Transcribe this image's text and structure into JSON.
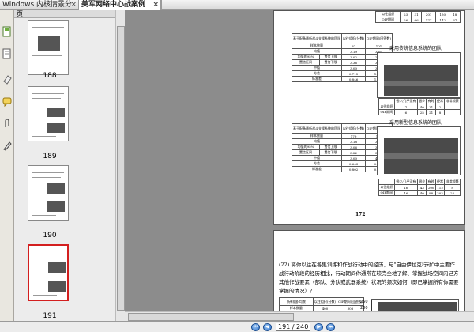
{
  "tabs": [
    {
      "label": "Windows 内核情景分"
    },
    {
      "label": "美军网络中心战案例"
    }
  ],
  "thumbnail_pane": {
    "header_label": "页",
    "pages": [
      {
        "label": "188"
      },
      {
        "label": "189"
      },
      {
        "label": "190"
      },
      {
        "label": "191",
        "selected": true
      }
    ]
  },
  "page1": {
    "table_top": {
      "rows": [
        [
          "以往组织",
          "23",
          "31",
          "201",
          "150",
          "18"
        ],
        [
          "OIF期间",
          "26",
          "66",
          "177",
          "142",
          "67"
        ]
      ]
    },
    "table1": {
      "header": [
        "基于配备最新战斗支援系统的团队",
        "以往组织(分数)",
        "OIF期间(回答数)"
      ],
      "rows": [
        [
          "样本数量",
          "97",
          "101"
        ],
        [
          "均值",
          "3.19",
          "3.09"
        ],
        [
          "均值的95%",
          "置信上限",
          "3.02",
          "2.68"
        ],
        [
          "置信区间",
          "置信下限",
          "3.36",
          "3.30"
        ],
        [
          "中值",
          "3.00",
          "3.00"
        ],
        [
          "方差",
          "0.715",
          "1.122"
        ],
        [
          "标准差",
          "0.846",
          "1.059"
        ]
      ]
    },
    "chart1": {
      "title": "采用传统信息系统的团队"
    },
    "small_table1": {
      "header": [
        "很少/几乎没有",
        "很少",
        "有时",
        "经常",
        "非常频繁"
      ],
      "rows": [
        [
          "以往组织",
          "7",
          "40",
          "31",
          "2"
        ],
        [
          "OIF期间",
          "6",
          "25",
          "21",
          "8"
        ]
      ]
    },
    "table2": {
      "header": [
        "基于配备最新战斗支援系统的团队",
        "以往组织(分数)",
        "OIF期间(回答数)"
      ],
      "rows": [
        [
          "样本数量",
          "179",
          "161"
        ],
        [
          "均值",
          "3.18",
          "3.31"
        ],
        [
          "均值的95%",
          "置信上限",
          "3.06",
          "3.42"
        ],
        [
          "置信区间",
          "置信下限",
          "3.22",
          "3.41"
        ],
        [
          "中值",
          "3.00",
          "4.00"
        ],
        [
          "方差",
          "0.643",
          "0.928"
        ],
        [
          "标准差",
          "0.802",
          "0.961"
        ]
      ]
    },
    "chart2": {
      "title": "采用新型信息系统的团队"
    },
    "small_table2": {
      "header": [
        "很少/几乎没有",
        "很少",
        "有时",
        "经常",
        "非常频繁"
      ],
      "rows": [
        [
          "以往组织",
          "16",
          "43",
          "200",
          "112",
          "8"
        ],
        [
          "OIF期间",
          "16",
          "40",
          "88",
          "202",
          "25"
        ]
      ]
    },
    "page_number": "172"
  },
  "page2": {
    "paragraph": "(22) 将你以往在各集训练和作战行动中的经历，与\"自由伊拉克行动\"中主要作战行动阶段的经历相比，行动期间你通常在较完全地了解、掌握战场空间内己方其他作战要素（部队、分队或武器系统）状况的频次如何（即已掌握所有你需要掌握的情况）？",
    "table": {
      "header": [
        "所有组织均数",
        "以往组织(分数)",
        "OIF期间(回答数)"
      ],
      "rows": [
        [
          "样本数量",
          "400",
          "308"
        ],
        [
          "均值",
          "3.12",
          "3.19"
        ],
        [
          "均值的95%",
          "置信上限",
          "2.43",
          "3.09"
        ],
        [
          "置信区间",
          "置信下限",
          "3.25",
          "3.34"
        ]
      ]
    },
    "chart_ticks": [
      "250",
      "200",
      "150",
      "100"
    ]
  },
  "statusbar": {
    "page_indicator": "191 / 240"
  },
  "colors": {
    "selection_border": "#d31f1f",
    "nav_button": "#2a6ec7",
    "doc_background": "#8c8c8c"
  }
}
